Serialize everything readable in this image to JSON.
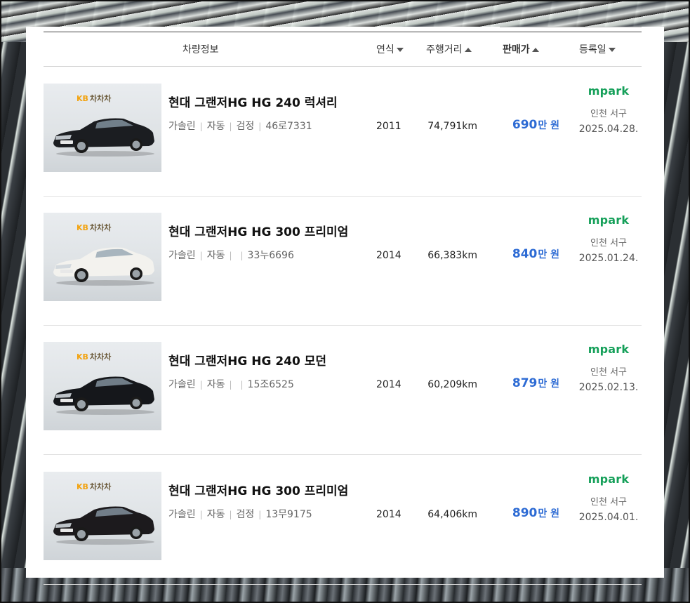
{
  "header": {
    "col_info": "차량정보",
    "col_year": "연식",
    "col_mileage": "주행거리",
    "col_price": "판매가",
    "col_date": "등록일"
  },
  "listings": [
    {
      "title": "현대 그랜저HG HG 240 럭셔리",
      "fuel": "가솔린",
      "transmission": "자동",
      "color": "검정",
      "plate": "46로7331",
      "year": "2011",
      "mileage": "74,791km",
      "price": "690",
      "price_unit": "만 원",
      "dealer_logo": "mpark",
      "location": "인천 서구",
      "date": "2025.04.28.",
      "thumb_badge_kb": "KB",
      "thumb_badge_brand": "차차차",
      "car_color": "#1b1d21"
    },
    {
      "title": "현대 그랜저HG HG 300 프리미엄",
      "fuel": "가솔린",
      "transmission": "자동",
      "color": "",
      "plate": "33누6696",
      "year": "2014",
      "mileage": "66,383km",
      "price": "840",
      "price_unit": "만 원",
      "dealer_logo": "mpark",
      "location": "인천 서구",
      "date": "2025.01.24.",
      "thumb_badge_kb": "KB",
      "thumb_badge_brand": "차차차",
      "car_color": "#f3f2ee"
    },
    {
      "title": "현대 그랜저HG HG 240 모던",
      "fuel": "가솔린",
      "transmission": "자동",
      "color": "",
      "plate": "15조6525",
      "year": "2014",
      "mileage": "60,209km",
      "price": "879",
      "price_unit": "만 원",
      "dealer_logo": "mpark",
      "location": "인천 서구",
      "date": "2025.02.13.",
      "thumb_badge_kb": "KB",
      "thumb_badge_brand": "차차차",
      "car_color": "#15171b"
    },
    {
      "title": "현대 그랜저HG HG 300 프리미엄",
      "fuel": "가솔린",
      "transmission": "자동",
      "color": "검정",
      "plate": "13무9175",
      "year": "2014",
      "mileage": "64,406km",
      "price": "890",
      "price_unit": "만 원",
      "dealer_logo": "mpark",
      "location": "인천 서구",
      "date": "2025.04.01.",
      "thumb_badge_kb": "KB",
      "thumb_badge_brand": "차차차",
      "car_color": "#1c1a1d"
    }
  ]
}
